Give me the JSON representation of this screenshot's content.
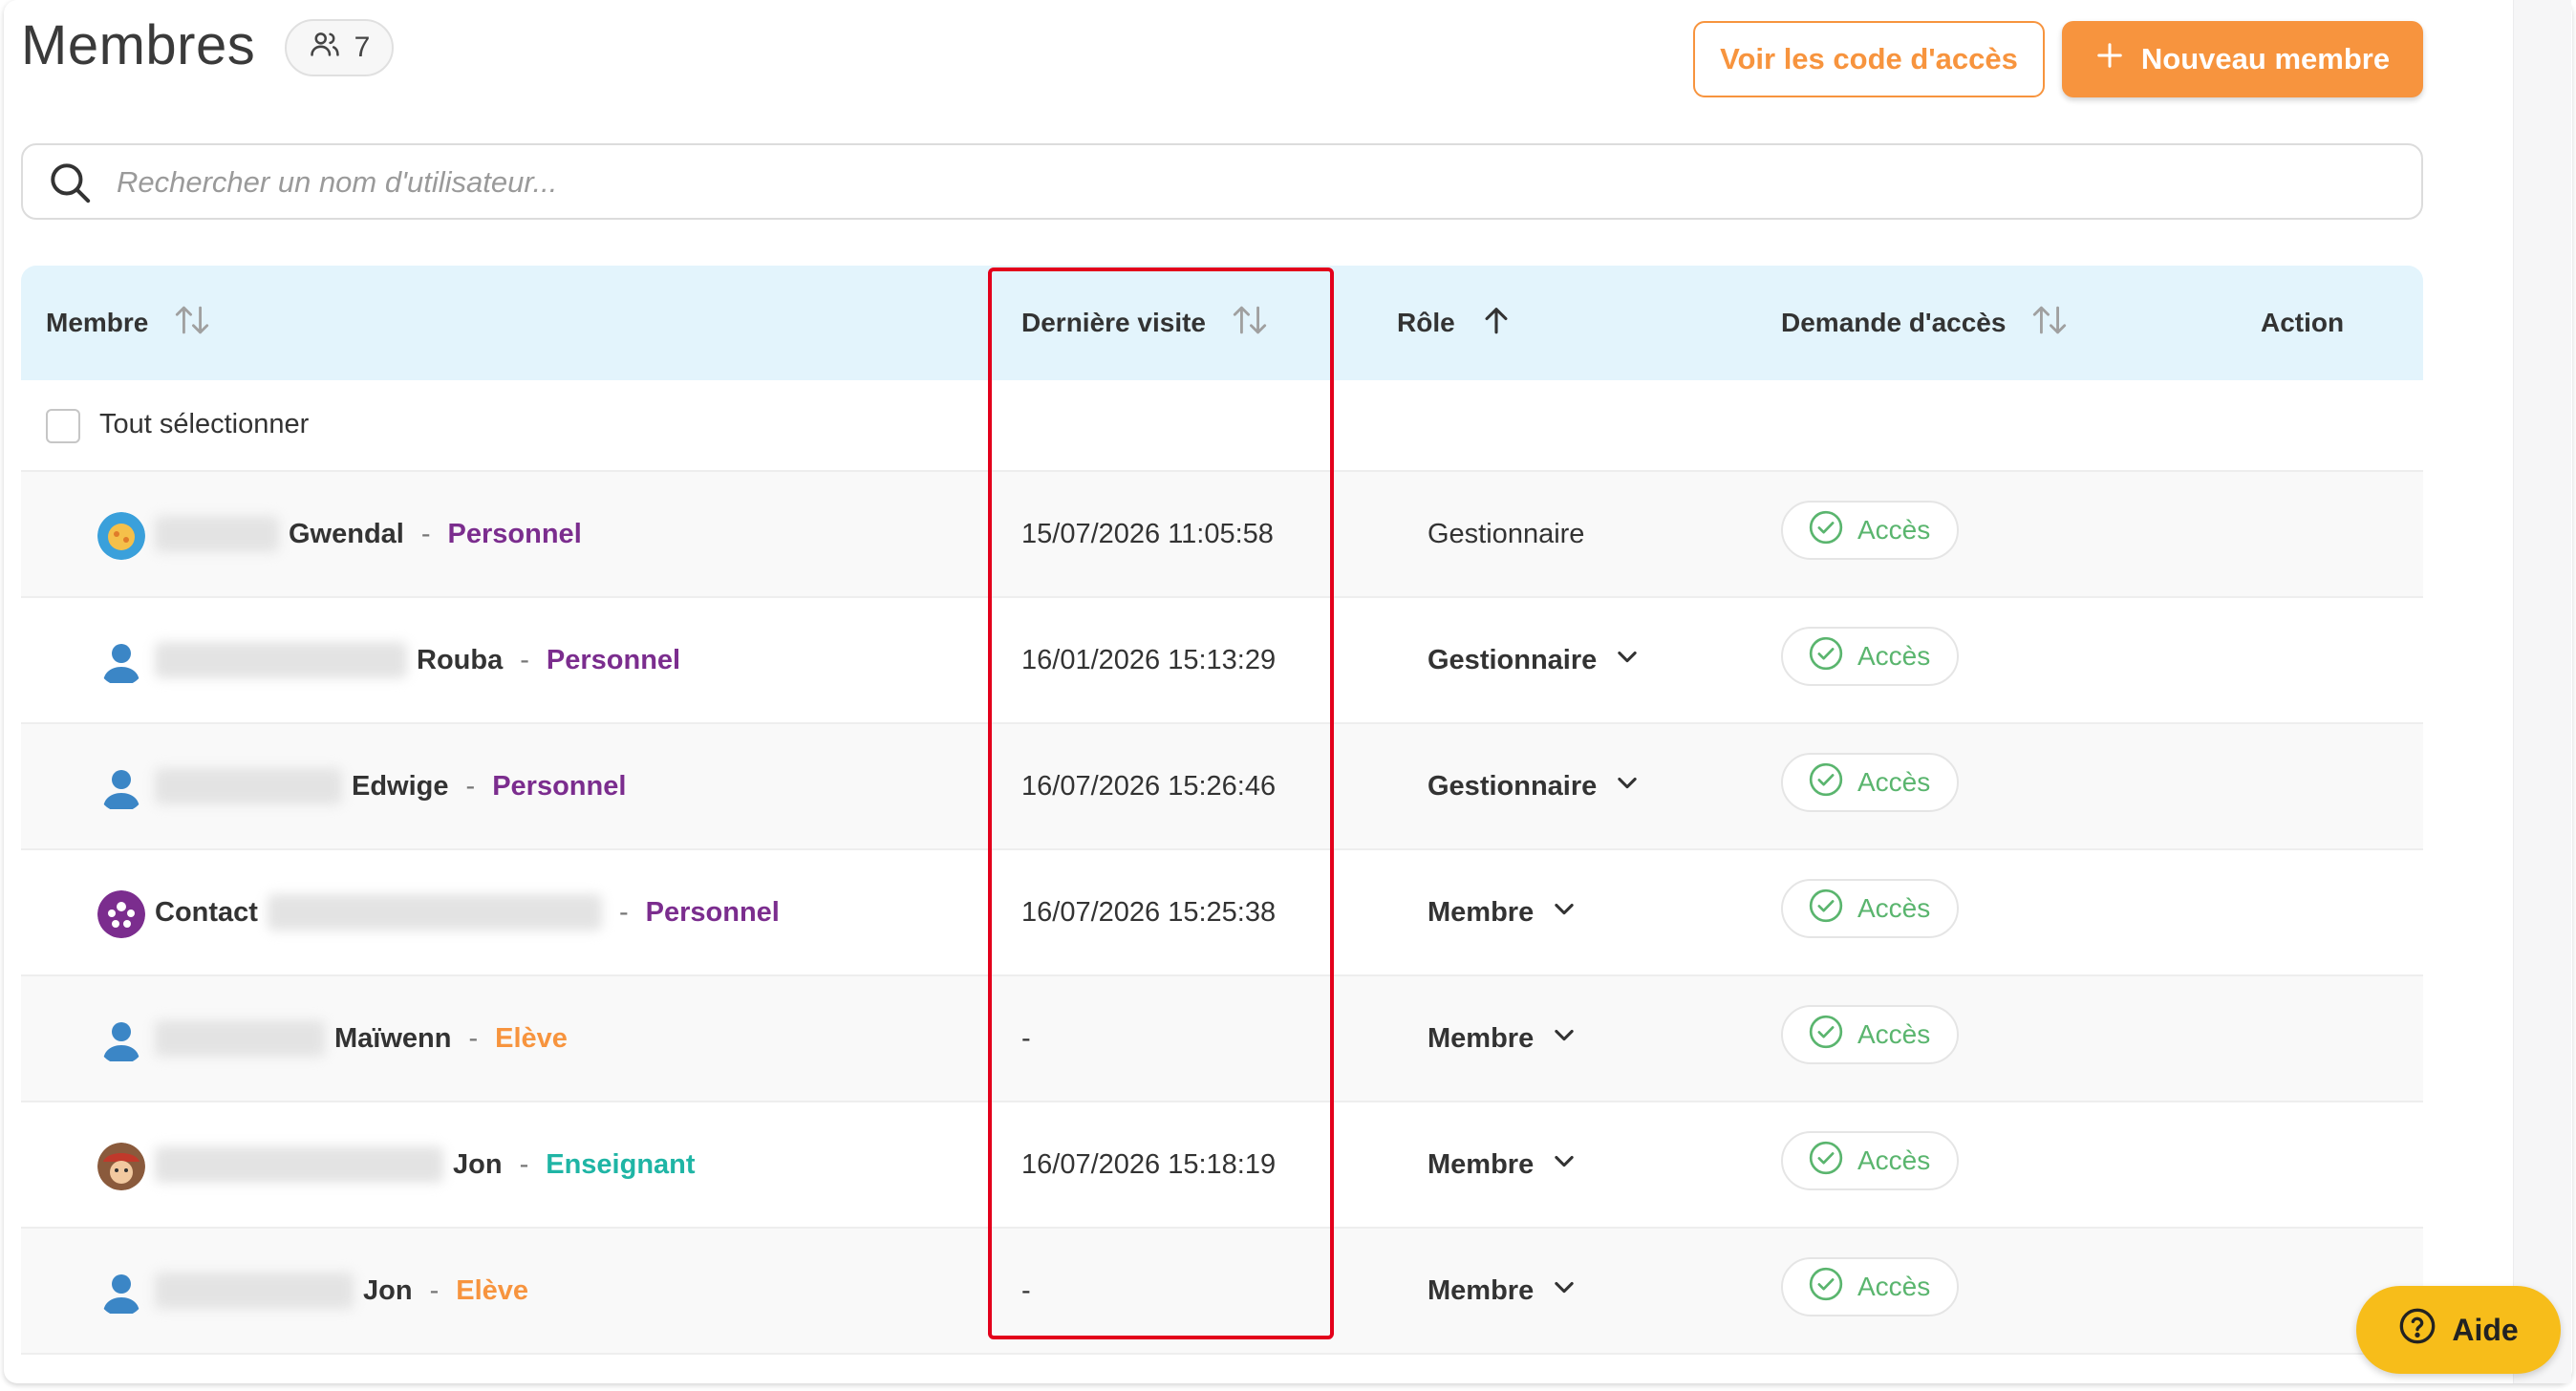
{
  "header": {
    "title": "Membres",
    "member_count": "7",
    "access_codes_button": "Voir les code d'accès",
    "new_member_button": "Nouveau membre"
  },
  "search": {
    "placeholder": "Rechercher un nom d'utilisateur..."
  },
  "table": {
    "columns": {
      "member": "Membre",
      "last_visit": "Dernière visite",
      "role": "Rôle",
      "access_request": "Demande d'accès",
      "action": "Action"
    },
    "select_all": "Tout sélectionner",
    "rows": [
      {
        "name_start": "",
        "name_end": "Gwendal",
        "type": "Personnel",
        "last_visit": "15/07/2026 11:05:58",
        "role": "Gestionnaire",
        "access": "Accès"
      },
      {
        "name_start": "",
        "name_end": "Rouba",
        "type": "Personnel",
        "last_visit": "16/01/2026 15:13:29",
        "role": "Gestionnaire",
        "access": "Accès"
      },
      {
        "name_start": "",
        "name_end": "Edwige",
        "type": "Personnel",
        "last_visit": "16/07/2026 15:26:46",
        "role": "Gestionnaire",
        "access": "Accès"
      },
      {
        "name_start": "Contact",
        "name_end": "",
        "type": "Personnel",
        "last_visit": "16/07/2026 15:25:38",
        "role": "Membre",
        "access": "Accès"
      },
      {
        "name_start": "",
        "name_end": "Maïwenn",
        "type": "Elève",
        "last_visit": "-",
        "role": "Membre",
        "access": "Accès"
      },
      {
        "name_start": "",
        "name_end": "Jon",
        "type": "Enseignant",
        "last_visit": "16/07/2026 15:18:19",
        "role": "Membre",
        "access": "Accès"
      },
      {
        "name_start": "",
        "name_end": "Jon",
        "type": "Elève",
        "last_visit": "-",
        "role": "Membre",
        "access": "Accès"
      }
    ]
  },
  "help_button": "Aide",
  "colors": {
    "accent_orange": "#f7943e",
    "header_blue": "#e3f4fc",
    "personnel_purple": "#7b2d8e",
    "enseignant_teal": "#1fb5a5",
    "access_green": "#5ab56e",
    "highlight_red": "#e3001b",
    "help_yellow": "#f7bd1a"
  },
  "icons": {
    "count_badge": "users-icon",
    "new_member": "plus-icon",
    "search": "search-icon",
    "sort": "sort-icon",
    "sort_asc": "arrow-up-icon",
    "role_dropdown": "chevron-down-icon",
    "access": "check-circle-icon",
    "help": "question-circle-icon"
  }
}
